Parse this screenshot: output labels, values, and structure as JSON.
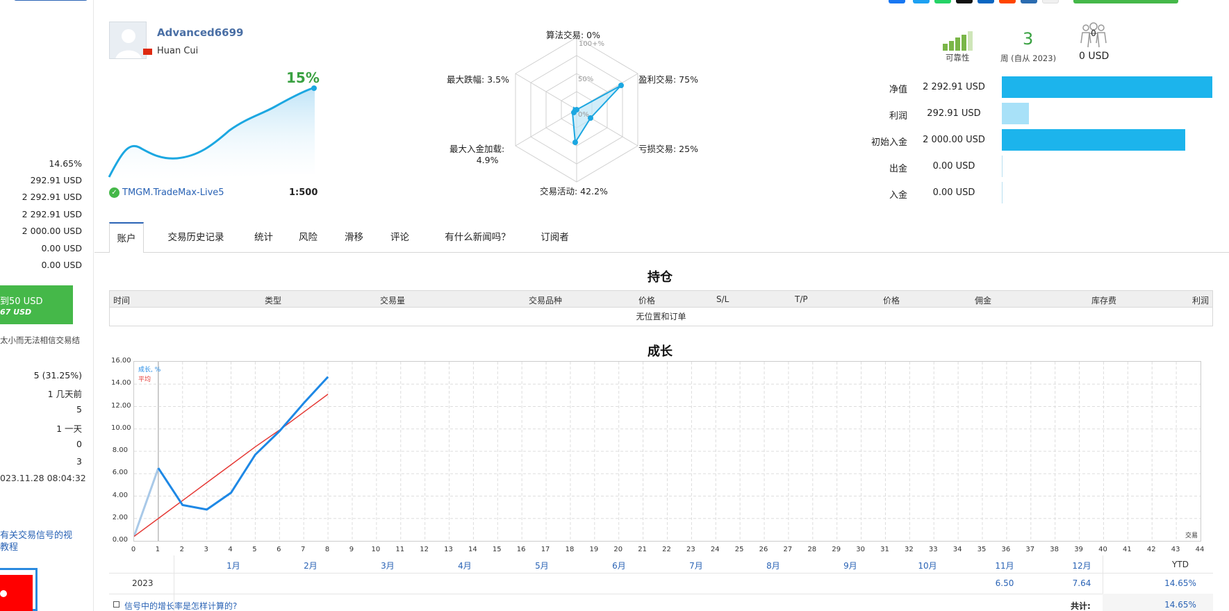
{
  "left_panel": {
    "stats": [
      "14.65%",
      "292.91 USD",
      "2 292.91 USD",
      "2 292.91 USD",
      "2 000.00 USD",
      "0.00 USD",
      "0.00 USD"
    ],
    "green_box": {
      "line1": "到50 USD",
      "line2": "67 USD"
    },
    "note": "太小而无法相信交易结",
    "stats2": [
      "5 (31.25%)",
      "1 几天前",
      "5",
      "1 一天",
      "0",
      "3"
    ],
    "date": "023.11.28 08:04:32",
    "video_link_l1": "有关交易信号的视",
    "video_link_l2": "教程"
  },
  "profile": {
    "username": "Advanced6699",
    "realname": "Huan Cui",
    "growth": "15%",
    "broker": "TMGM.TradeMax-Live5",
    "leverage": "1:500"
  },
  "radar": {
    "algo": "算法交易: 0%",
    "profit_trades": "盈利交易: 75%",
    "loss_trades": "亏损交易: 25%",
    "activity": "交易活动: 42.2%",
    "max_deposit_load_l1": "最大入金加载:",
    "max_deposit_load_l2": "4.9%",
    "max_drawdown": "最大跌幅: 3.5%",
    "scale_100": "100+%",
    "scale_50": "50%",
    "scale_0": "0%"
  },
  "summary": {
    "reliability_label": "可靠性",
    "weeks_num": "3",
    "weeks_label": "周 (自从 2023)",
    "subscribers_count": "0",
    "subscribers_value": "0 USD"
  },
  "balances": [
    {
      "label": "净值",
      "value": "2 292.91 USD",
      "fill": 1.0,
      "color": "#1cb4ec"
    },
    {
      "label": "利润",
      "value": "292.91 USD",
      "fill": 0.128,
      "color": "#a8e1f8"
    },
    {
      "label": "初始入金",
      "value": "2 000.00 USD",
      "fill": 0.872,
      "color": "#1cb4ec"
    },
    {
      "label": "出金",
      "value": "0.00 USD",
      "fill": 0.0,
      "color": "#1cb4ec"
    },
    {
      "label": "入金",
      "value": "0.00 USD",
      "fill": 0.0,
      "color": "#1cb4ec"
    }
  ],
  "tabs": [
    "账户",
    "交易历史记录",
    "统计",
    "风险",
    "滑移",
    "评论",
    "有什么新闻吗？",
    "订阅者"
  ],
  "positions": {
    "title": "持仓",
    "columns": [
      "时间",
      "类型",
      "交易量",
      "交易品种",
      "价格",
      "S/L",
      "T/P",
      "价格",
      "佣金",
      "库存费",
      "利润"
    ],
    "empty": "无位置和订单"
  },
  "growth": {
    "title": "成长",
    "legend_growth": "成长, %",
    "legend_avg": "平均",
    "x_axis_label": "交易",
    "months": [
      "1月",
      "2月",
      "3月",
      "4月",
      "5月",
      "6月",
      "7月",
      "8月",
      "9月",
      "10月",
      "11月",
      "12月",
      "YTD"
    ],
    "year": "2023",
    "nov": "6.50",
    "dec": "7.64",
    "ytd": "14.65%",
    "faq": "信号中的增长率是怎样计算的?",
    "total_label": "共计:",
    "total_value": "14.65%"
  },
  "chart_data": {
    "type": "line",
    "x": [
      0,
      1,
      2,
      3,
      4,
      5,
      6,
      7,
      8
    ],
    "series": [
      {
        "name": "成长, %",
        "values": [
          0.4,
          6.5,
          3.2,
          2.8,
          4.3,
          7.7,
          9.8,
          12.3,
          14.65
        ]
      },
      {
        "name": "平均",
        "values": [
          0.4,
          2.0,
          3.6,
          5.2,
          6.8,
          8.4,
          9.9,
          11.5,
          13.1
        ]
      }
    ],
    "xlim": [
      0,
      44
    ],
    "ylim": [
      0,
      16
    ],
    "yticks": [
      "0.00",
      "2.00",
      "4.00",
      "6.00",
      "8.00",
      "10.00",
      "12.00",
      "14.00",
      "16.00"
    ],
    "grid": true
  },
  "colors": {
    "accent": "#2a63b5",
    "green": "#45b849",
    "bar": "#1cb4ec",
    "line": "#1e88e5",
    "avg": "#e53935"
  }
}
